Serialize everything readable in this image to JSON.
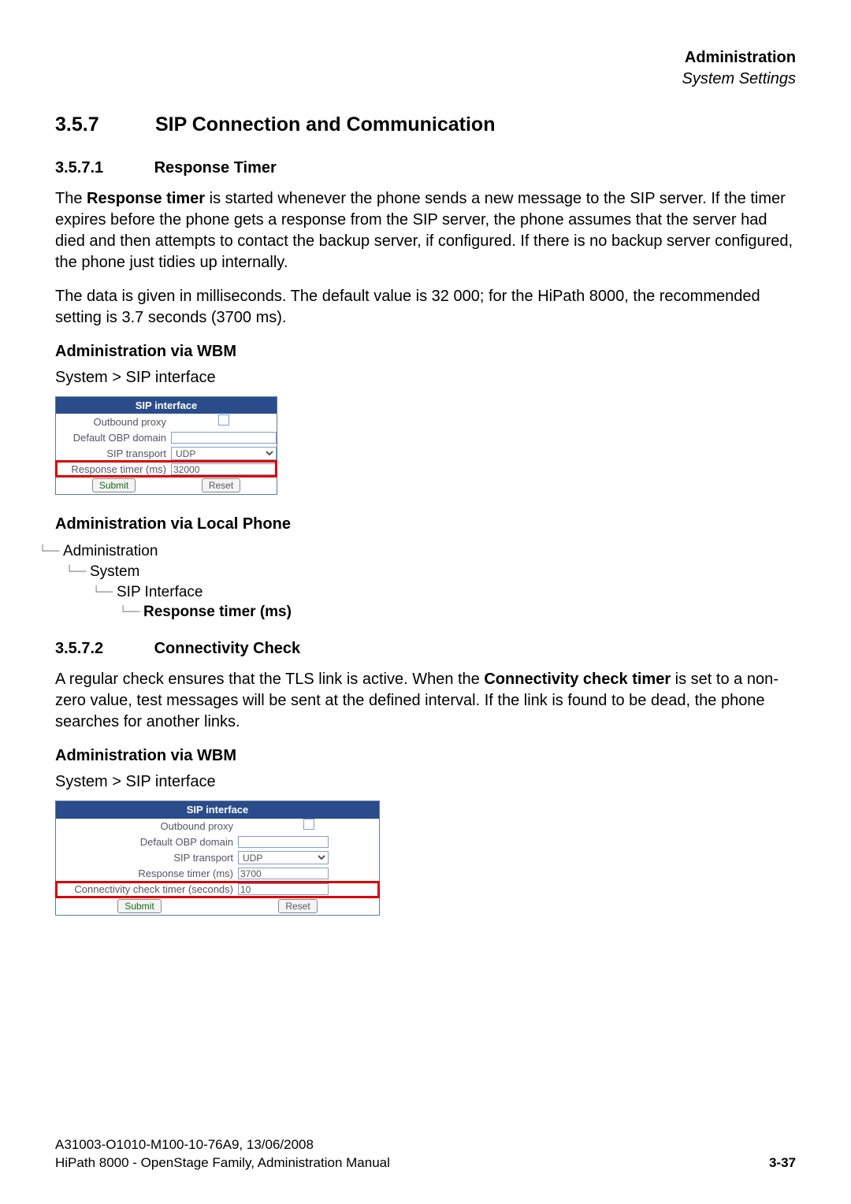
{
  "header": {
    "title": "Administration",
    "subtitle": "System Settings"
  },
  "h2": {
    "num": "3.5.7",
    "title": "SIP Connection and Communication"
  },
  "s571": {
    "num": "3.5.7.1",
    "title": "Response Timer",
    "p1a": "The ",
    "p1b": "Response timer",
    "p1c": " is started whenever the phone sends a new message to the SIP server. If the timer expires before the phone gets a response from the SIP server, the phone assumes that the server had died and then attempts to contact the backup server, if configured. If there is no backup server configured, the phone just tidies up internally.",
    "p2": "The data is given in milliseconds. The default value is 32 000; for the HiPath 8000, the recommended setting is 3.7 seconds (3700 ms)."
  },
  "wbm_label": "Administration via WBM",
  "local_label": "Administration via Local Phone",
  "crumb": "System > SIP interface",
  "sip_box1": {
    "title": "SIP interface",
    "rows": {
      "outbound_proxy": "Outbound proxy",
      "default_obp": "Default OBP domain",
      "transport": "SIP transport",
      "transport_val": "UDP",
      "resp_timer": "Response timer (ms)",
      "resp_timer_val": "32000"
    },
    "submit": "Submit",
    "reset": "Reset"
  },
  "tree": {
    "l0": "Administration",
    "l1": "System",
    "l2": "SIP Interface",
    "l3": "Response timer (ms)"
  },
  "s572": {
    "num": "3.5.7.2",
    "title": "Connectivity Check",
    "p1a": "A regular check ensures that the TLS link is active. When the ",
    "p1b": "Connectivity check timer",
    "p1c": " is set to a non-zero value, test messages will be sent at the defined interval. If the link is found to be dead, the phone searches for another links."
  },
  "sip_box2": {
    "title": "SIP interface",
    "rows": {
      "outbound_proxy": "Outbound proxy",
      "default_obp": "Default OBP domain",
      "transport": "SIP transport",
      "transport_val": "UDP",
      "resp_timer": "Response timer (ms)",
      "resp_timer_val": "3700",
      "conn_check": "Connectivity check timer (seconds)",
      "conn_check_val": "10"
    },
    "submit": "Submit",
    "reset": "Reset"
  },
  "footer": {
    "line1": "A31003-O1010-M100-10-76A9, 13/06/2008",
    "line2": "HiPath 8000 - OpenStage Family, Administration Manual",
    "page": "3-37"
  }
}
